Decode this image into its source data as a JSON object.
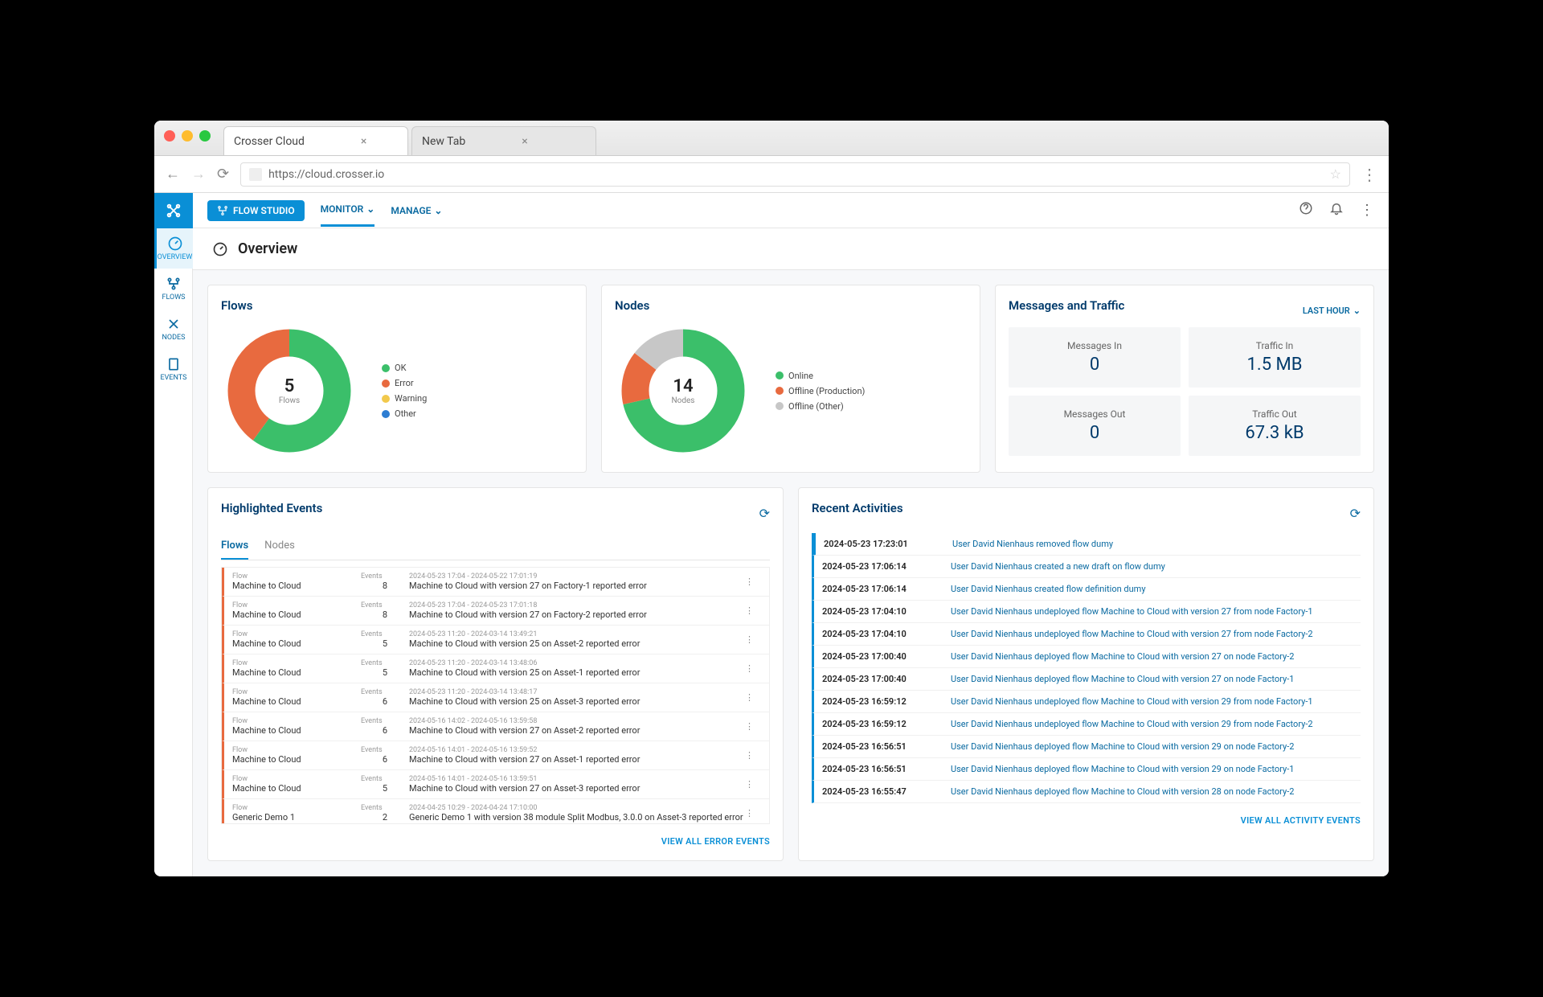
{
  "browser": {
    "tabs": [
      {
        "title": "Crosser Cloud",
        "active": true
      },
      {
        "title": "New Tab",
        "active": false
      }
    ],
    "url": "https://cloud.crosser.io"
  },
  "sidebar": {
    "items": [
      {
        "label": "OVERVIEW",
        "icon": "gauge"
      },
      {
        "label": "FLOWS",
        "icon": "flow"
      },
      {
        "label": "NODES",
        "icon": "node"
      },
      {
        "label": "EVENTS",
        "icon": "clipboard"
      }
    ]
  },
  "topbar": {
    "flow_studio": "FLOW STUDIO",
    "monitor": "MONITOR",
    "manage": "MANAGE"
  },
  "page": {
    "title": "Overview"
  },
  "flows_card": {
    "title": "Flows",
    "center_value": "5",
    "center_label": "Flows",
    "legend": [
      {
        "label": "OK",
        "color": "#3bbf6a"
      },
      {
        "label": "Error",
        "color": "#e86a3f"
      },
      {
        "label": "Warning",
        "color": "#f2c94c"
      },
      {
        "label": "Other",
        "color": "#2d7dd2"
      }
    ]
  },
  "nodes_card": {
    "title": "Nodes",
    "center_value": "14",
    "center_label": "Nodes",
    "legend": [
      {
        "label": "Online",
        "color": "#3bbf6a"
      },
      {
        "label": "Offline (Production)",
        "color": "#e86a3f"
      },
      {
        "label": "Offline (Other)",
        "color": "#c7c7c7"
      }
    ]
  },
  "messages_card": {
    "title": "Messages and Traffic",
    "range": "LAST HOUR",
    "metrics": [
      {
        "label": "Messages In",
        "value": "0"
      },
      {
        "label": "Traffic In",
        "value": "1.5 MB"
      },
      {
        "label": "Messages Out",
        "value": "0"
      },
      {
        "label": "Traffic Out",
        "value": "67.3 kB"
      }
    ]
  },
  "highlighted": {
    "title": "Highlighted Events",
    "tabs": [
      {
        "label": "Flows"
      },
      {
        "label": "Nodes"
      }
    ],
    "col_flow": "Flow",
    "col_events": "Events",
    "rows": [
      {
        "name": "Machine to Cloud",
        "count": "8",
        "range": "2024-05-23 17:04 - 2024-05-22 17:01:19",
        "desc": "Machine to Cloud with version 27 on Factory-1 reported error"
      },
      {
        "name": "Machine to Cloud",
        "count": "8",
        "range": "2024-05-23 17:04 - 2024-05-23 17:01:18",
        "desc": "Machine to Cloud with version 27 on Factory-2 reported error"
      },
      {
        "name": "Machine to Cloud",
        "count": "5",
        "range": "2024-05-23 11:20 - 2024-03-14 13:49:21",
        "desc": "Machine to Cloud with version 25 on Asset-2 reported error"
      },
      {
        "name": "Machine to Cloud",
        "count": "5",
        "range": "2024-05-23 11:20 - 2024-03-14 13:48:06",
        "desc": "Machine to Cloud with version 25 on Asset-1 reported error"
      },
      {
        "name": "Machine to Cloud",
        "count": "6",
        "range": "2024-05-23 11:20 - 2024-03-14 13:48:17",
        "desc": "Machine to Cloud with version 25 on Asset-3 reported error"
      },
      {
        "name": "Machine to Cloud",
        "count": "6",
        "range": "2024-05-16 14:02 - 2024-05-16 13:59:58",
        "desc": "Machine to Cloud with version 27 on Asset-2 reported error"
      },
      {
        "name": "Machine to Cloud",
        "count": "6",
        "range": "2024-05-16 14:01 - 2024-05-16 13:59:52",
        "desc": "Machine to Cloud with version 27 on Asset-1 reported error"
      },
      {
        "name": "Machine to Cloud",
        "count": "5",
        "range": "2024-05-16 14:01 - 2024-05-16 13:59:51",
        "desc": "Machine to Cloud with version 27 on Asset-3 reported error"
      },
      {
        "name": "Generic Demo 1",
        "count": "2",
        "range": "2024-04-25 10:29 - 2024-04-24 17:10:00",
        "desc": "Generic Demo 1 with version 38 module Split Modbus, 3.0.0 on Asset-3 reported error"
      }
    ],
    "footer": "VIEW ALL ERROR EVENTS"
  },
  "activities": {
    "title": "Recent Activities",
    "rows": [
      {
        "time": "2024-05-23 17:23:01",
        "text": "User David Nienhaus removed flow dumy"
      },
      {
        "time": "2024-05-23 17:06:14",
        "text": "User David Nienhaus created a new draft on flow dumy"
      },
      {
        "time": "2024-05-23 17:06:14",
        "text": "User David Nienhaus created flow definition dumy"
      },
      {
        "time": "2024-05-23 17:04:10",
        "text": "User David Nienhaus undeployed flow Machine to Cloud with version 27 from node Factory-1"
      },
      {
        "time": "2024-05-23 17:04:10",
        "text": "User David Nienhaus undeployed flow Machine to Cloud with version 27 from node Factory-2"
      },
      {
        "time": "2024-05-23 17:00:40",
        "text": "User David Nienhaus deployed flow Machine to Cloud with version 27 on node Factory-2"
      },
      {
        "time": "2024-05-23 17:00:40",
        "text": "User David Nienhaus deployed flow Machine to Cloud with version 27 on node Factory-1"
      },
      {
        "time": "2024-05-23 16:59:12",
        "text": "User David Nienhaus undeployed flow Machine to Cloud with version 29 from node Factory-1"
      },
      {
        "time": "2024-05-23 16:59:12",
        "text": "User David Nienhaus undeployed flow Machine to Cloud with version 29 from node Factory-2"
      },
      {
        "time": "2024-05-23 16:56:51",
        "text": "User David Nienhaus deployed flow Machine to Cloud with version 29 on node Factory-2"
      },
      {
        "time": "2024-05-23 16:56:51",
        "text": "User David Nienhaus deployed flow Machine to Cloud with version 29 on node Factory-1"
      },
      {
        "time": "2024-05-23 16:55:47",
        "text": "User David Nienhaus deployed flow Machine to Cloud with version 28 on node Factory-2"
      }
    ],
    "footer": "VIEW ALL ACTIVITY EVENTS"
  },
  "chart_data": [
    {
      "type": "pie",
      "title": "Flows",
      "series": [
        {
          "name": "Flows",
          "values": [
            3,
            2,
            0,
            0
          ]
        }
      ],
      "categories": [
        "OK",
        "Error",
        "Warning",
        "Other"
      ],
      "colors": [
        "#3bbf6a",
        "#e86a3f",
        "#f2c94c",
        "#2d7dd2"
      ],
      "total": 5
    },
    {
      "type": "pie",
      "title": "Nodes",
      "series": [
        {
          "name": "Nodes",
          "values": [
            10,
            2,
            2
          ]
        }
      ],
      "categories": [
        "Online",
        "Offline (Production)",
        "Offline (Other)"
      ],
      "colors": [
        "#3bbf6a",
        "#e86a3f",
        "#c7c7c7"
      ],
      "total": 14
    }
  ]
}
